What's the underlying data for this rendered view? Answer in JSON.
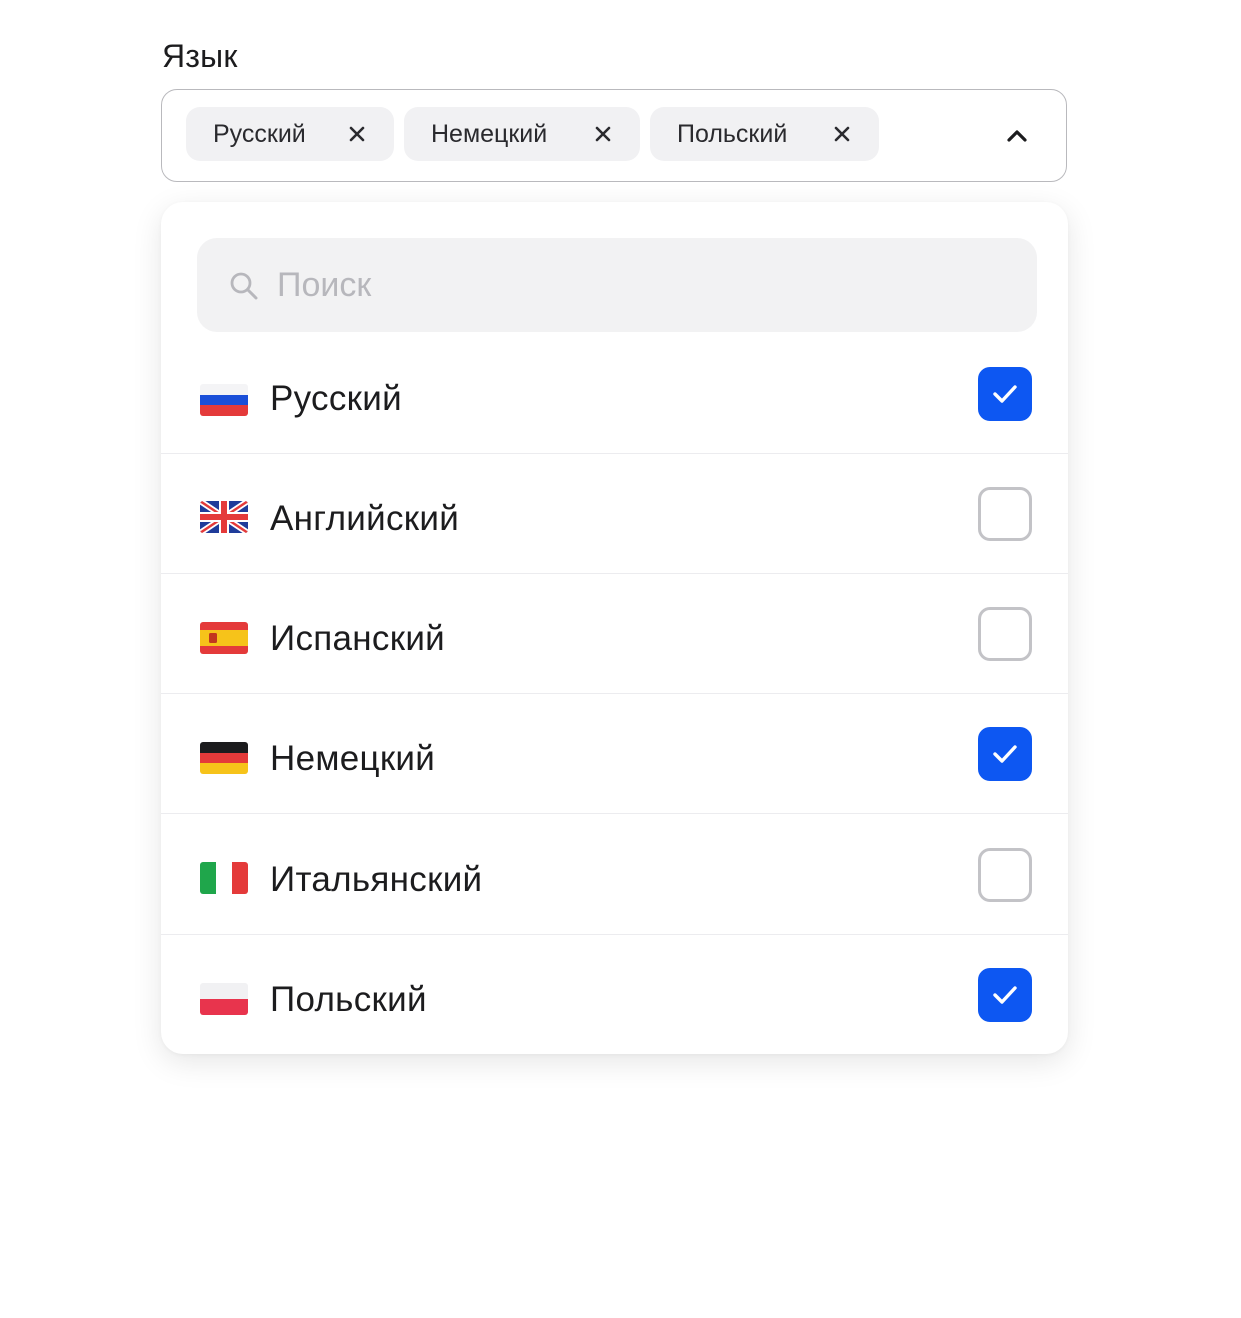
{
  "field": {
    "label": "Язык"
  },
  "chips": [
    {
      "label": "Русский"
    },
    {
      "label": "Немецкий"
    },
    {
      "label": "Польский"
    }
  ],
  "search": {
    "placeholder": "Поиск",
    "value": ""
  },
  "options": [
    {
      "label": "Русский",
      "flag": "russia-flag-icon",
      "checked": true
    },
    {
      "label": "Английский",
      "flag": "uk-flag-icon",
      "checked": false
    },
    {
      "label": "Испанский",
      "flag": "spain-flag-icon",
      "checked": false
    },
    {
      "label": "Немецкий",
      "flag": "germany-flag-icon",
      "checked": true
    },
    {
      "label": "Итальянский",
      "flag": "italy-flag-icon",
      "checked": false
    },
    {
      "label": "Польский",
      "flag": "poland-flag-icon",
      "checked": true
    }
  ],
  "colors": {
    "accent": "#0d57f2",
    "chip_bg": "#f1f1f3",
    "border": "#b9b9bd"
  }
}
